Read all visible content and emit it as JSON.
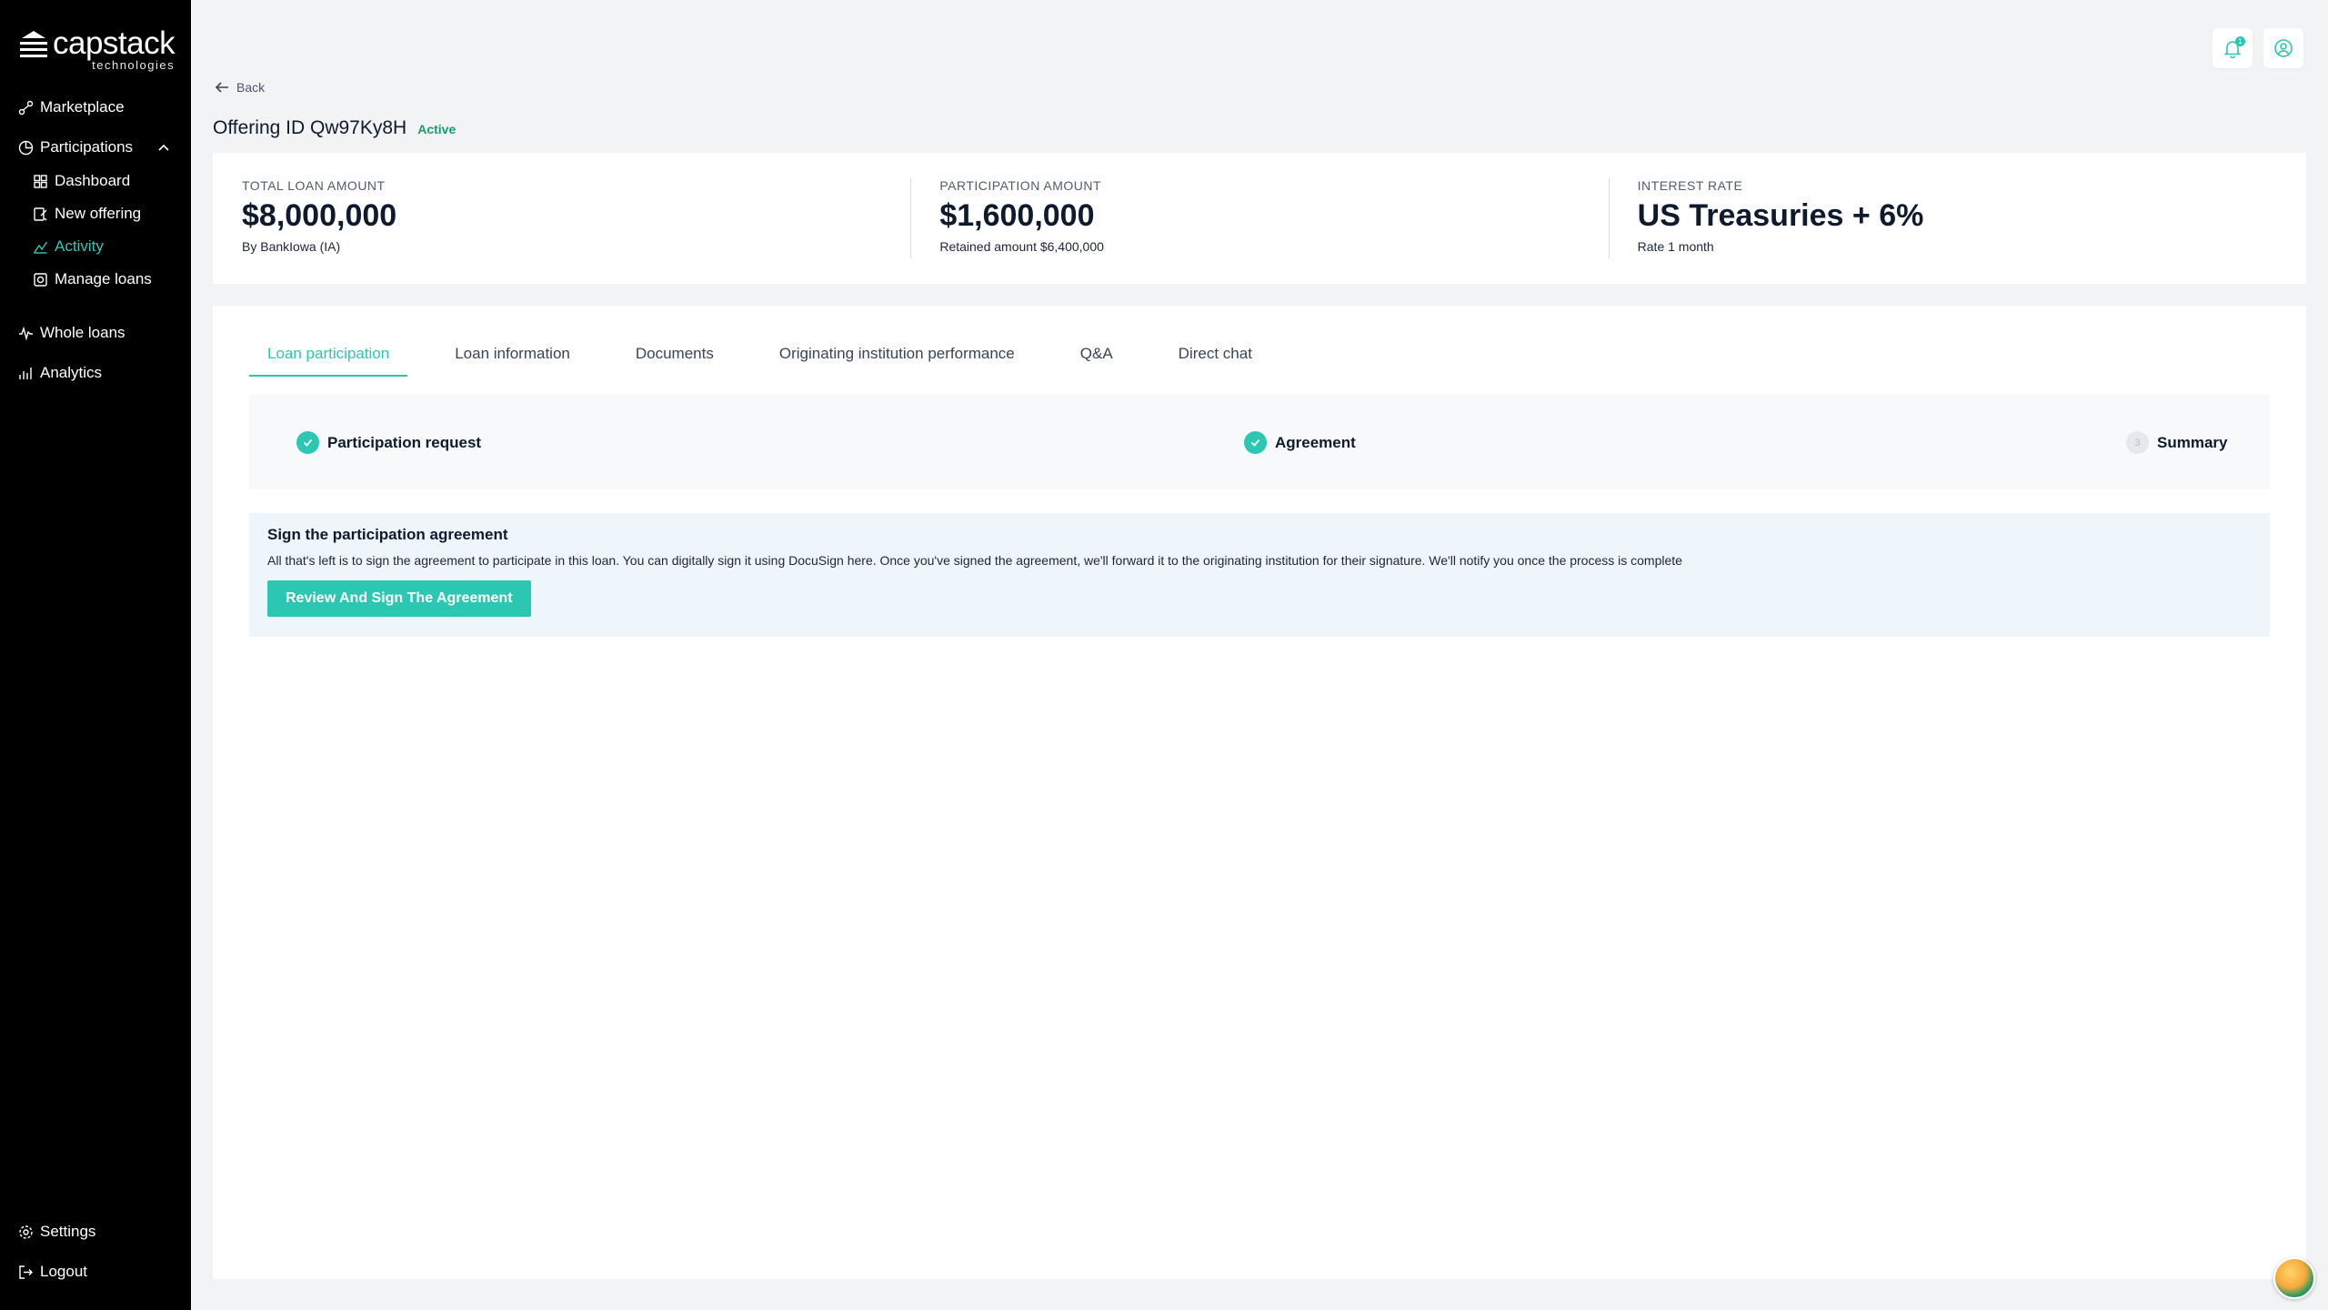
{
  "brand": {
    "name": "capstack",
    "subtitle": "technologies"
  },
  "sidebar": {
    "items": [
      {
        "label": "Marketplace",
        "icon": "marketplace-icon"
      },
      {
        "label": "Participations",
        "icon": "participations-icon"
      },
      {
        "label": "Dashboard",
        "icon": "dashboard-icon"
      },
      {
        "label": "New offering",
        "icon": "new-offering-icon"
      },
      {
        "label": "Activity",
        "icon": "activity-icon"
      },
      {
        "label": "Manage loans",
        "icon": "manage-loans-icon"
      },
      {
        "label": "Whole loans",
        "icon": "whole-loans-icon"
      },
      {
        "label": "Analytics",
        "icon": "analytics-icon"
      }
    ],
    "settings": "Settings",
    "logout": "Logout"
  },
  "header": {
    "notification_count": "1"
  },
  "back_label": "Back",
  "offering": {
    "title": "Offering ID Qw97Ky8H",
    "status": "Active"
  },
  "stats": [
    {
      "label": "TOTAL LOAN AMOUNT",
      "value": "$8,000,000",
      "sub": "By BankIowa (IA)"
    },
    {
      "label": "PARTICIPATION AMOUNT",
      "value": "$1,600,000",
      "sub": "Retained amount $6,400,000"
    },
    {
      "label": "INTEREST RATE",
      "value": "US Treasuries + 6%",
      "sub": "Rate 1 month"
    }
  ],
  "tabs": [
    "Loan participation",
    "Loan information",
    "Documents",
    "Originating institution performance",
    "Q&A",
    "Direct chat"
  ],
  "steps": [
    {
      "label": "Participation request",
      "state": "done"
    },
    {
      "label": "Agreement",
      "state": "done"
    },
    {
      "label": "Summary",
      "state": "pending",
      "number": "3"
    }
  ],
  "sign": {
    "title": "Sign the participation agreement",
    "description": "All that's left is to sign the agreement to participate in this loan. You can digitally sign it using DocuSign here. Once you've signed the agreement, we'll forward it to the originating institution for their signature. We'll notify you once the process is complete",
    "button": "Review And Sign The Agreement"
  },
  "colors": {
    "accent": "#2cc7b3",
    "active_status": "#15a06b",
    "sidebar_bg": "#000000"
  }
}
